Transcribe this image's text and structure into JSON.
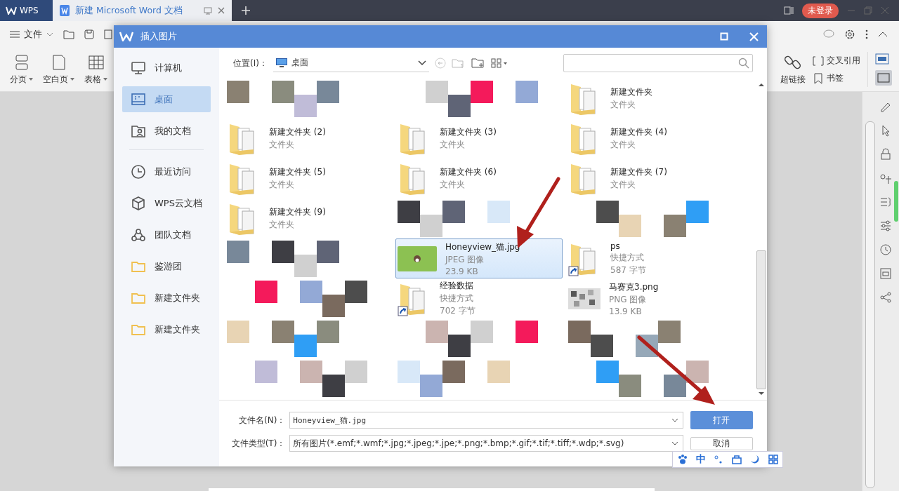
{
  "app_tabs": [
    {
      "label": "WPS",
      "kind": "home",
      "selected": false
    },
    {
      "label": "新建 Microsoft Word 文档",
      "kind": "doc",
      "selected": true
    }
  ],
  "login_badge": "未登录",
  "menu": {
    "label": "文件"
  },
  "ribbon_left": [
    {
      "label": "分页"
    },
    {
      "label": "空白页"
    },
    {
      "label": "表格"
    }
  ],
  "ribbon_right": {
    "big": {
      "label": "超链接"
    },
    "small": [
      {
        "label": "交叉引用"
      },
      {
        "label": "书签"
      }
    ]
  },
  "dialog": {
    "title": "插入图片",
    "nav": [
      {
        "label": "计算机",
        "selected": false
      },
      {
        "label": "桌面",
        "selected": true
      },
      {
        "label": "我的文档",
        "selected": false
      },
      {
        "label": "最近访问",
        "selected": false
      },
      {
        "label": "WPS云文档",
        "selected": false
      },
      {
        "label": "团队文档",
        "selected": false
      },
      {
        "label": "鉴游团",
        "selected": false
      },
      {
        "label": "新建文件夹",
        "selected": false
      },
      {
        "label": "新建文件夹",
        "selected": false
      }
    ],
    "location_label": "位置(I)：",
    "location": "桌面",
    "files": [
      {
        "kind": "blurred"
      },
      {
        "kind": "blurred"
      },
      {
        "kind": "folder",
        "name": "新建文件夹",
        "type": "文件夹",
        "selected": false
      },
      {
        "kind": "folder",
        "name": "新建文件夹 (2)",
        "type": "文件夹",
        "selected": false
      },
      {
        "kind": "folder",
        "name": "新建文件夹 (3)",
        "type": "文件夹",
        "selected": false
      },
      {
        "kind": "folder",
        "name": "新建文件夹 (4)",
        "type": "文件夹",
        "selected": false
      },
      {
        "kind": "folder",
        "name": "新建文件夹 (5)",
        "type": "文件夹",
        "selected": false
      },
      {
        "kind": "folder",
        "name": "新建文件夹 (6)",
        "type": "文件夹",
        "selected": false
      },
      {
        "kind": "folder",
        "name": "新建文件夹 (7)",
        "type": "文件夹",
        "selected": false
      },
      {
        "kind": "folder",
        "name": "新建文件夹 (9)",
        "type": "文件夹",
        "selected": false
      },
      {
        "kind": "blurred"
      },
      {
        "kind": "blurred"
      },
      {
        "kind": "blurred"
      },
      {
        "kind": "jpg",
        "name": "Honeyview_猫.jpg",
        "type": "JPEG 图像",
        "size": "23.9 KB",
        "selected": true
      },
      {
        "kind": "shortcut",
        "name": "ps",
        "type": "快捷方式",
        "size": "587 字节",
        "selected": false
      },
      {
        "kind": "blurred"
      },
      {
        "kind": "shortcut",
        "name": "经验数据",
        "type": "快捷方式",
        "size": "702 字节",
        "selected": false
      },
      {
        "kind": "png",
        "name": "马赛克3.png",
        "type": "PNG 图像",
        "size": "13.9 KB",
        "selected": false
      },
      {
        "kind": "blurred"
      },
      {
        "kind": "blurred"
      },
      {
        "kind": "blurred"
      },
      {
        "kind": "blurred"
      },
      {
        "kind": "blurred"
      },
      {
        "kind": "blurred"
      }
    ],
    "filename_label": "文件名(N)：",
    "filename": "Honeyview_猫.jpg",
    "filetype_label": "文件类型(T)：",
    "filetype": "所有图片(*.emf;*.wmf;*.jpg;*.jpeg;*.jpe;*.png;*.bmp;*.gif;*.tif;*.tiff;*.wdp;*.svg)",
    "open_button": "打开",
    "cancel_button": "取消"
  },
  "ime_bar": {
    "mode": "中"
  }
}
